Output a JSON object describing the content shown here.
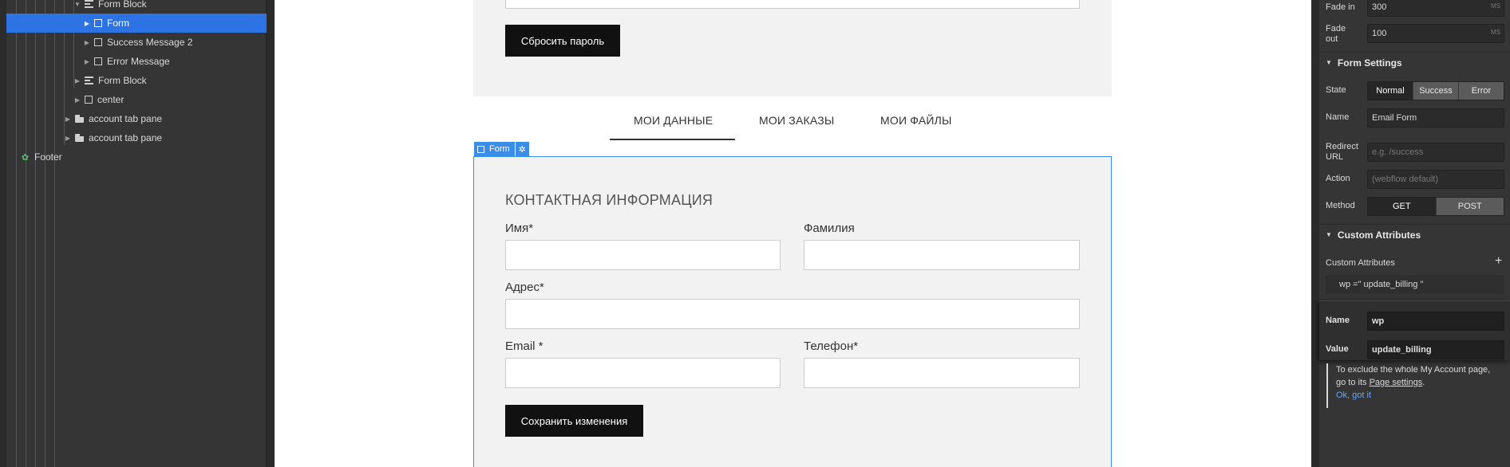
{
  "navigator": {
    "items": [
      {
        "label": "Form Block",
        "icon": "form-block-icon"
      },
      {
        "label": "Form",
        "icon": "box-icon",
        "selected": true
      },
      {
        "label": "Success Message 2",
        "icon": "box-icon"
      },
      {
        "label": "Error Message",
        "icon": "box-icon"
      },
      {
        "label": "Form Block",
        "icon": "form-block-icon"
      },
      {
        "label": "center",
        "icon": "box-icon"
      },
      {
        "label": "account tab pane",
        "icon": "tab-pane-icon"
      },
      {
        "label": "account tab pane",
        "icon": "tab-pane-icon"
      },
      {
        "label": "Footer",
        "icon": "symbol-icon"
      }
    ]
  },
  "canvas": {
    "reset_password_button": "Сбросить пароль",
    "tabs": [
      "МОИ ДАННЫЕ",
      "МОИ ЗАКАЗЫ",
      "МОИ ФАЙЛЫ"
    ],
    "selection_badge": "Form",
    "form": {
      "heading": "КОНТАКТНАЯ ИНФОРМАЦИЯ",
      "first_name_label": "Имя*",
      "last_name_label": "Фамилия",
      "address_label": "Адрес*",
      "email_label": "Email *",
      "phone_label": "Телефон*",
      "save_button": "Сохранить изменения"
    }
  },
  "style_panel": {
    "fade_in_label": "Fade in",
    "fade_in_value": "300",
    "fade_out_label": "Fade out",
    "fade_out_value": "100",
    "unit": "MS",
    "form_settings": {
      "title": "Form Settings",
      "state_label": "State",
      "states": [
        "Normal",
        "Success",
        "Error"
      ],
      "active_state": "Normal",
      "name_label": "Name",
      "name_value": "Email Form",
      "redirect_label_1": "Redirect",
      "redirect_label_2": "URL",
      "redirect_placeholder": "e.g. /success",
      "action_label": "Action",
      "action_placeholder": "(webflow default)",
      "method_label": "Method",
      "methods": [
        "GET",
        "POST"
      ],
      "active_method": "POST"
    },
    "custom_attributes": {
      "title": "Custom Attributes",
      "list_label": "Custom Attributes",
      "add_icon": "plus-icon",
      "attribute_row": "wp =\" update_billing \"",
      "popup_name_label": "Name",
      "popup_name_value": "wp",
      "popup_value_label": "Value",
      "popup_value_value": "update_billing"
    },
    "note": {
      "text_1": "To exclude the whole My Account page, go to its ",
      "link": "Page settings",
      "text_2": ".",
      "ok": "Ok, got it"
    }
  }
}
